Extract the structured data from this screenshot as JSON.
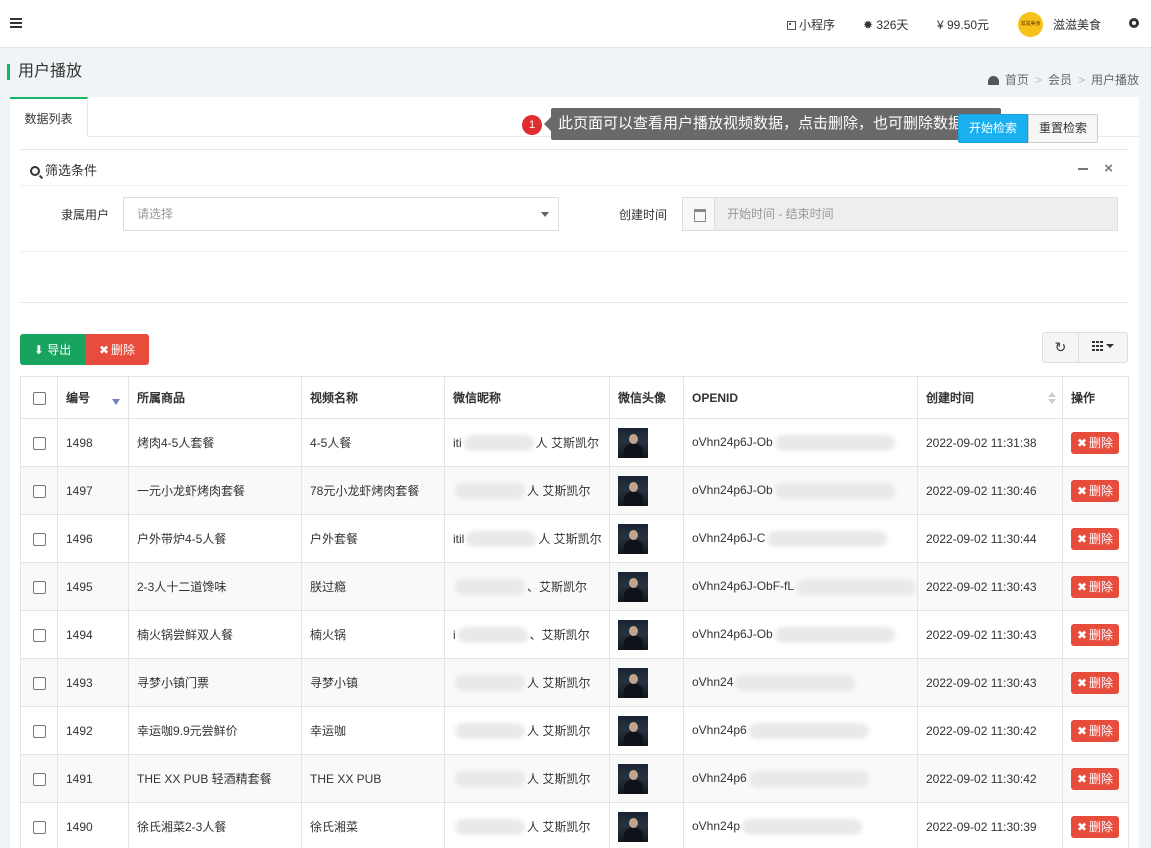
{
  "topbar": {
    "miniprogram": "小程序",
    "days": "326天",
    "balance": "¥ 99.50元",
    "shop_name": "滋滋美食",
    "avatar_text": "滋滋美食"
  },
  "page": {
    "title": "用户播放",
    "breadcrumb": [
      "首页",
      "会员",
      "用户播放"
    ]
  },
  "tabs": [
    "数据列表"
  ],
  "tooltip": {
    "number": "1",
    "text": "此页面可以查看用户播放视频数据，点击删除，也可删除数据"
  },
  "filter": {
    "title": "筛选条件",
    "user_label": "隶属用户",
    "user_placeholder": "请选择",
    "time_label": "创建时间",
    "time_placeholder": "开始时间 - 结束时间",
    "search_btn": "开始检索",
    "reset_btn": "重置检索"
  },
  "toolbar": {
    "export": "导出",
    "delete": "删除"
  },
  "table": {
    "headers": [
      "编号",
      "所属商品",
      "视频名称",
      "微信昵称",
      "微信头像",
      "OPENID",
      "创建时间",
      "操作"
    ],
    "delete_label": "删除",
    "rows": [
      {
        "id": "1498",
        "product": "烤肉4-5人套餐",
        "video": "4-5人餐",
        "nick_pre": "iti",
        "nick_post": "人 艾斯凯尔",
        "openid": "oVhn24p6J-Ob",
        "time": "2022-09-02 11:31:38"
      },
      {
        "id": "1497",
        "product": "一元小龙虾烤肉套餐",
        "video": "78元小龙虾烤肉套餐",
        "nick_pre": "",
        "nick_post": "人 艾斯凯尔",
        "openid": "oVhn24p6J-Ob",
        "time": "2022-09-02 11:30:46"
      },
      {
        "id": "1496",
        "product": "户外带炉4-5人餐",
        "video": "户外套餐",
        "nick_pre": "itil",
        "nick_post": "人 艾斯凯尔",
        "openid": "oVhn24p6J-C",
        "time": "2022-09-02 11:30:44"
      },
      {
        "id": "1495",
        "product": "2-3人十二道馋味",
        "video": "朕过瘾",
        "nick_pre": "",
        "nick_post": "、艾斯凯尔",
        "openid": "oVhn24p6J-ObF-fL",
        "time": "2022-09-02 11:30:43"
      },
      {
        "id": "1494",
        "product": "楠火锅尝鲜双人餐",
        "video": "楠火锅",
        "nick_pre": "i",
        "nick_post": "、艾斯凯尔",
        "openid": "oVhn24p6J-Ob",
        "time": "2022-09-02 11:30:43"
      },
      {
        "id": "1493",
        "product": "寻梦小镇门票",
        "video": "寻梦小镇",
        "nick_pre": "",
        "nick_post": "人 艾斯凯尔",
        "openid": "oVhn24",
        "time": "2022-09-02 11:30:43"
      },
      {
        "id": "1492",
        "product": "幸运咖9.9元尝鲜价",
        "video": "幸运咖",
        "nick_pre": "",
        "nick_post": "人 艾斯凯尔",
        "openid": "oVhn24p6",
        "time": "2022-09-02 11:30:42"
      },
      {
        "id": "1491",
        "product": "THE XX PUB 轻酒精套餐",
        "video": "THE XX PUB",
        "nick_pre": "",
        "nick_post": "人 艾斯凯尔",
        "openid": "oVhn24p6",
        "time": "2022-09-02 11:30:42"
      },
      {
        "id": "1490",
        "product": "徐氏湘菜2-3人餐",
        "video": "徐氏湘菜",
        "nick_pre": "",
        "nick_post": "人 艾斯凯尔",
        "openid": "oVhn24p",
        "time": "2022-09-02 11:30:39"
      }
    ]
  }
}
